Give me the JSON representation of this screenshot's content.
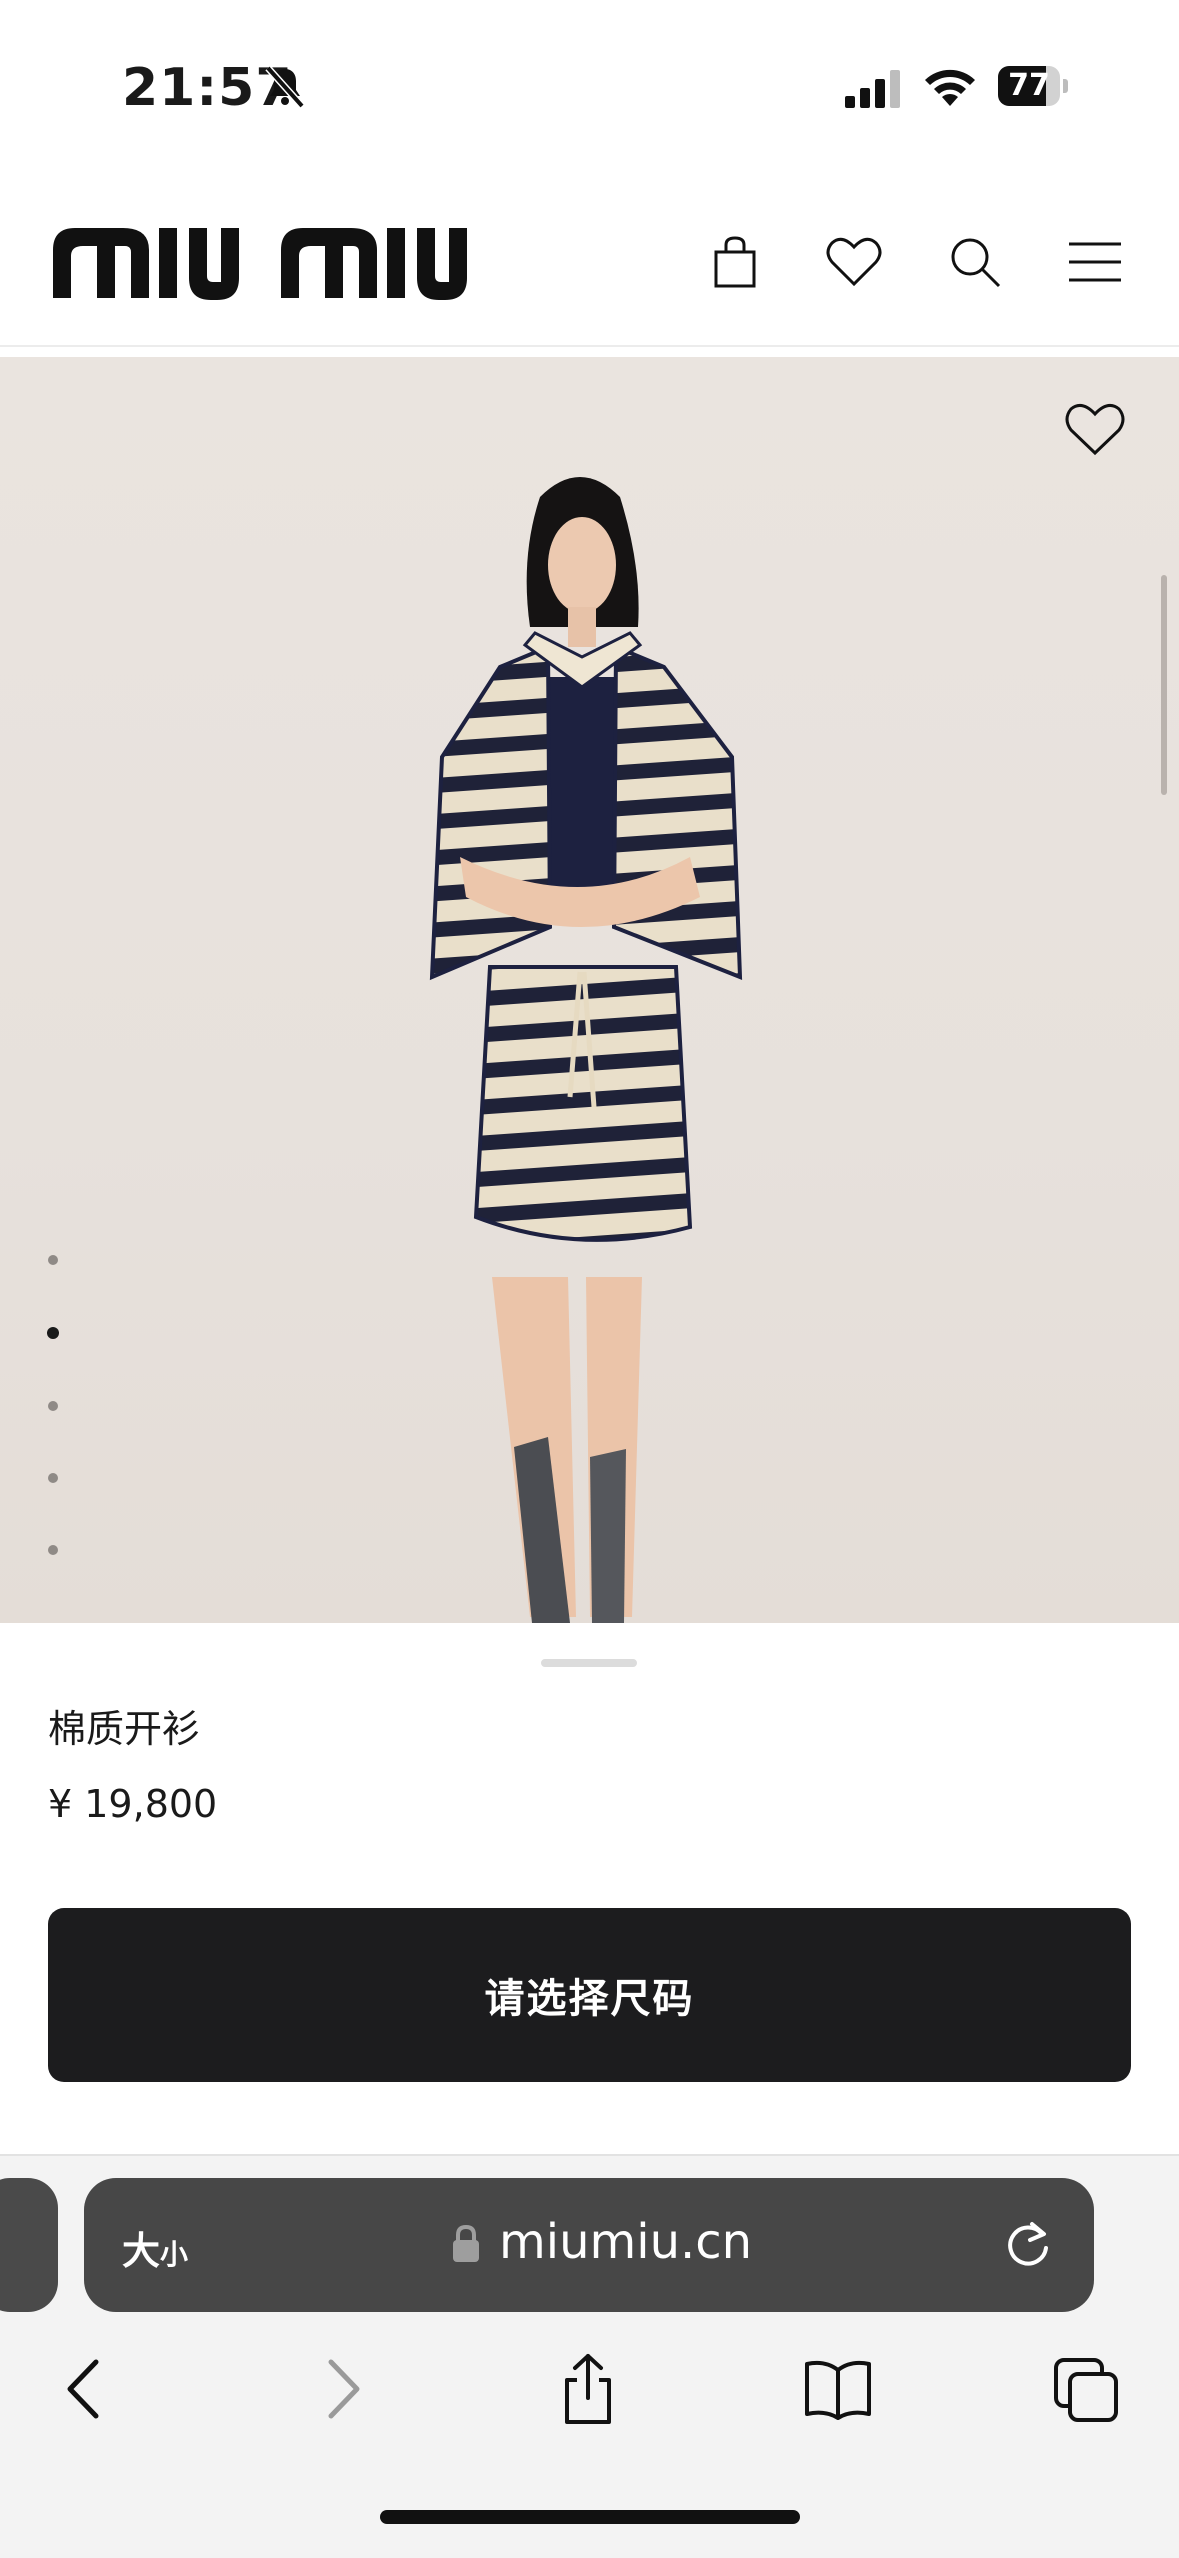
{
  "status_bar": {
    "time": "21:57",
    "battery": "77",
    "battery_level": 0.77
  },
  "header": {
    "logo_text": "miu miu",
    "icons": [
      "shopping-bag-icon",
      "heart-icon",
      "search-icon",
      "hamburger-menu-icon"
    ]
  },
  "gallery": {
    "image_count": 5,
    "active_index": 1
  },
  "product": {
    "name": "棉质开衫",
    "price": "¥ 19,800",
    "cta_label": "请选择尺码"
  },
  "browser": {
    "text_size_label_big": "大",
    "text_size_label_small": "小",
    "url": "miumiu.cn"
  },
  "colors": {
    "cta_background": "#1c1c1e",
    "image_background": "#e7e1dc",
    "address_bar": "#474747"
  }
}
